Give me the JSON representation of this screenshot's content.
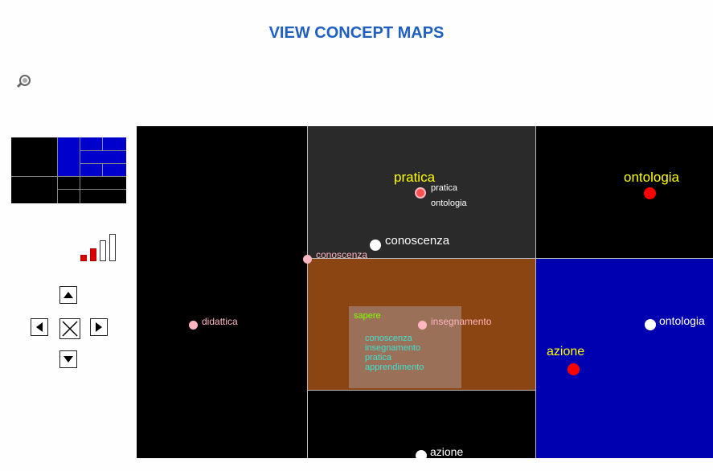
{
  "page": {
    "title": "VIEW CONCEPT MAPS"
  },
  "controls": {
    "zoom_icon": "magnifier-icon",
    "zoom_level_active_bars": 2,
    "zoom_level_total_bars": 4,
    "nav": [
      "pan-up",
      "pan-left",
      "reset-view",
      "pan-right",
      "pan-down"
    ]
  },
  "colors": {
    "title": "#1f5fbf",
    "tile_dark": "#2a2a2a",
    "tile_brown": "#8b4513",
    "tile_blue": "#0000b0",
    "label_yellow": "#ffff00",
    "node_red": "#ff0000",
    "node_pink": "#ffb6c1",
    "inner_green": "#7fff00",
    "inner_cyan": "#40e0d0"
  },
  "map": {
    "labels": {
      "pratica_big": "pratica",
      "ontologia_big": "ontologia",
      "pratica_small": "pratica",
      "ontologia_small": "ontologia",
      "conoscenza_big": "conoscenza",
      "conoscenza_small": "conoscenza",
      "didattica": "didattica",
      "insegnamento": "insegnamento",
      "ontologia_right": "ontologia",
      "azione_big": "azione",
      "azione_bottom": "azione"
    },
    "inner_list": {
      "head": "sapere",
      "items": [
        "conoscenza",
        "insegnamento",
        "pratica",
        "apprendimento"
      ]
    }
  }
}
